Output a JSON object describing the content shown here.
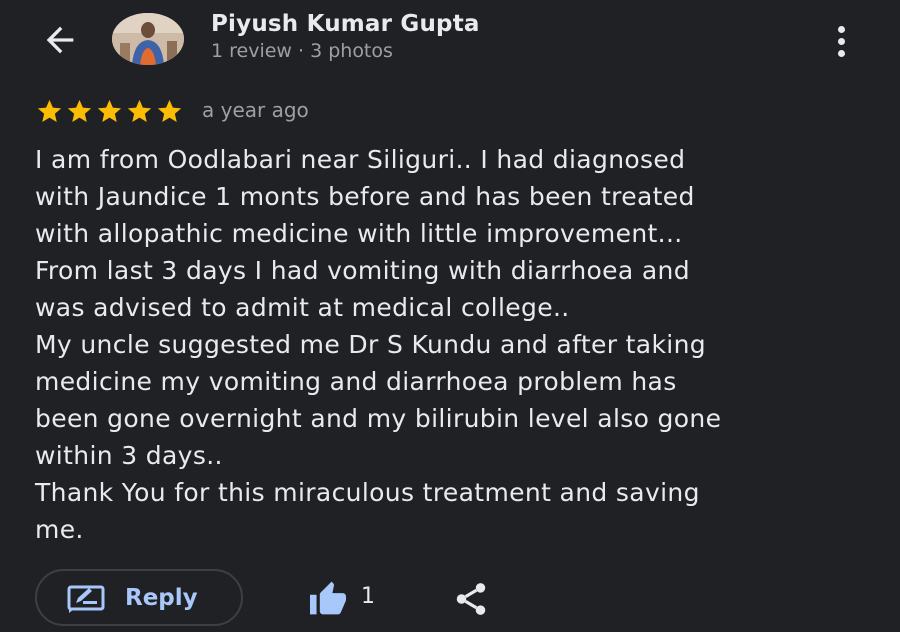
{
  "author": {
    "name": "Piyush Kumar Gupta",
    "meta": "1 review · 3 photos"
  },
  "review": {
    "rating": 5,
    "max_rating": 5,
    "time": "a year ago",
    "lines": [
      "I am from Oodlabari near Siliguri.. I had diagnosed",
      "with Jaundice 1 monts before and has been treated",
      "with allopathic medicine with little improvement...",
      "From last 3 days I had vomiting with diarrhoea and",
      "was advised to admit at medical college..",
      "My uncle suggested me Dr S Kundu and after taking",
      "medicine my vomiting and diarrhoea problem has",
      "been gone overnight and my bilirubin level also gone",
      "within 3 days..",
      "Thank You for this miraculous treatment and saving",
      "me."
    ]
  },
  "actions": {
    "reply_label": "Reply",
    "like_count": "1"
  },
  "icons": {
    "back": "arrow-back-icon",
    "more": "more-vert-icon",
    "star": "star-icon",
    "reply": "reply-edit-icon",
    "like": "thumb-up-icon",
    "share": "share-icon"
  },
  "colors": {
    "background": "#202124",
    "text_primary": "#e8eaed",
    "text_secondary": "#9aa0a6",
    "star": "#fbbc04",
    "accent_blue": "#a8c7fa",
    "button_border": "#3c4043"
  }
}
